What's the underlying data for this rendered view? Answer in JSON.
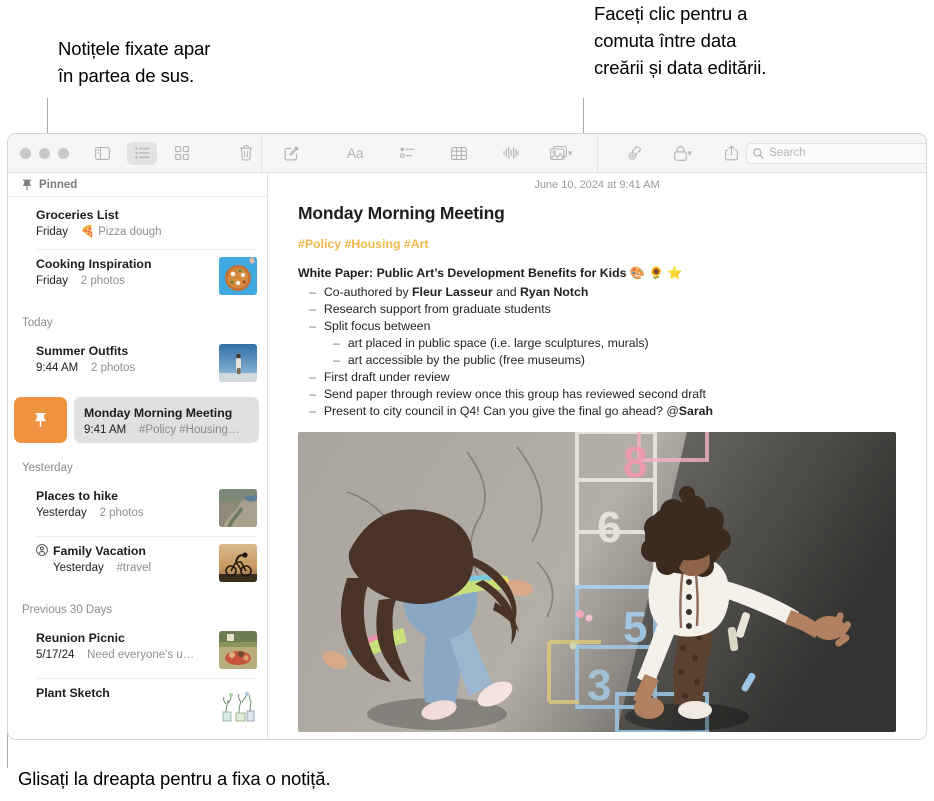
{
  "callouts": {
    "pinned": "Notițele fixate apar\nîn partea de sus.",
    "date": "Faceți clic pentru a\ncomuta între data\ncreării și data editării.",
    "swipe": "Glisați la dreapta pentru a fixa o notiță."
  },
  "toolbar": {
    "icons": {
      "sidebar_toggle": "sidebar-icon",
      "list_view": "list-view-icon",
      "gallery_view": "gallery-view-icon",
      "delete": "trash-icon",
      "compose": "compose-icon",
      "format": "Aa",
      "checklist": "checklist-icon",
      "table": "table-icon",
      "audio": "audio-waveform-icon",
      "media": "media-icon",
      "link": "link-icon",
      "lock": "lock-icon",
      "share": "share-icon"
    },
    "search_placeholder": "Search"
  },
  "sidebar": {
    "pinned_label": "Pinned",
    "sections": [
      {
        "header": null,
        "notes": [
          {
            "title": "Groceries List",
            "date": "Friday",
            "preview": "🍕 Pizza dough",
            "thumb": null,
            "shared": false
          },
          {
            "title": "Cooking Inspiration",
            "date": "Friday",
            "preview": "2 photos",
            "thumb": "pizza",
            "shared": false
          }
        ]
      },
      {
        "header": "Today",
        "notes": [
          {
            "title": "Summer Outfits",
            "date": "9:44 AM",
            "preview": "2 photos",
            "thumb": "beach",
            "shared": false
          }
        ]
      },
      {
        "header": "Yesterday",
        "notes": [
          {
            "title": "Places to hike",
            "date": "Yesterday",
            "preview": "2 photos",
            "thumb": "hike",
            "shared": false
          },
          {
            "title": "Family Vacation",
            "date": "Yesterday",
            "preview": "#travel",
            "thumb": "bike",
            "shared": true
          }
        ]
      },
      {
        "header": "Previous 30 Days",
        "notes": [
          {
            "title": "Reunion Picnic",
            "date": "5/17/24",
            "preview": "Need everyone's u…",
            "thumb": "picnic",
            "shared": false
          },
          {
            "title": "Plant Sketch",
            "date": "",
            "preview": "",
            "thumb": "plants",
            "shared": false
          }
        ]
      }
    ],
    "selected_note": {
      "title": "Monday Morning Meeting",
      "date": "9:41 AM",
      "preview": "#Policy #Housing…",
      "pin_action_icon": "pin-icon",
      "pin_action_color": "#EE9440"
    }
  },
  "note": {
    "date_header": "June 10, 2024 at 9:41 AM",
    "title": "Monday Morning Meeting",
    "tags": "#Policy #Housing #Art",
    "tags_color": "#F0B849",
    "lead": "White Paper: Public Art’s Development Benefits for Kids 🎨 🌻 ⭐",
    "bullets": [
      {
        "level": 1,
        "parts": [
          {
            "t": "Co-authored by ",
            "b": false
          },
          {
            "t": "Fleur Lasseur",
            "b": true
          },
          {
            "t": " and ",
            "b": false
          },
          {
            "t": "Ryan Notch",
            "b": true
          }
        ]
      },
      {
        "level": 1,
        "parts": [
          {
            "t": "Research support from graduate students",
            "b": false
          }
        ]
      },
      {
        "level": 1,
        "parts": [
          {
            "t": "Split focus between",
            "b": false
          }
        ]
      },
      {
        "level": 2,
        "parts": [
          {
            "t": "art placed in public space (i.e. large sculptures, murals)",
            "b": false
          }
        ]
      },
      {
        "level": 2,
        "parts": [
          {
            "t": "art accessible by the public (free museums)",
            "b": false
          }
        ]
      },
      {
        "level": 1,
        "parts": [
          {
            "t": "First draft under review",
            "b": false
          }
        ]
      },
      {
        "level": 1,
        "parts": [
          {
            "t": "Send paper through review once this group has reviewed second draft",
            "b": false
          }
        ]
      },
      {
        "level": 1,
        "parts": [
          {
            "t": "Present to city council in Q4! Can you give the final go ahead? @",
            "b": false
          },
          {
            "t": "Sarah",
            "b": true
          }
        ]
      }
    ],
    "photo_alt": "Two children playing hopscotch on asphalt with chalk numbers"
  }
}
